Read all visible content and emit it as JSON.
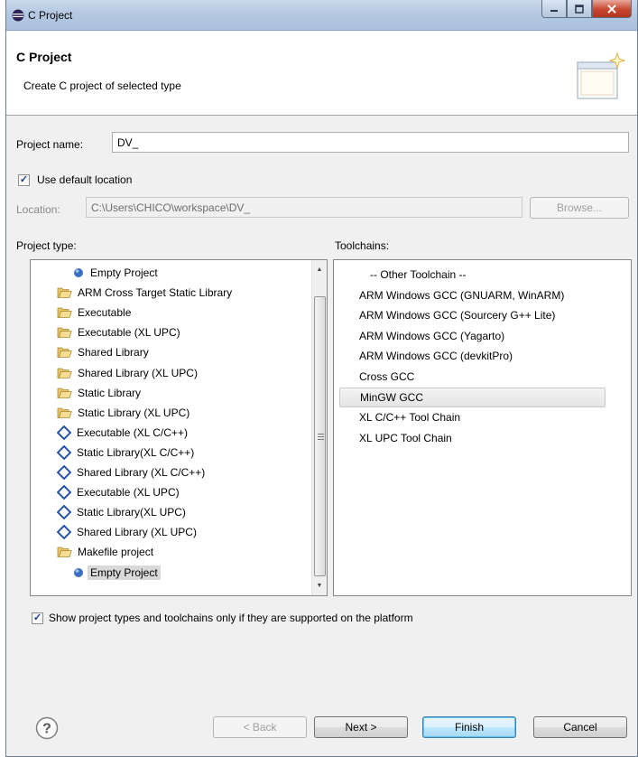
{
  "window": {
    "title": "C Project"
  },
  "banner": {
    "heading": "C Project",
    "description": "Create C project of selected type"
  },
  "project_name": {
    "label": "Project name:",
    "value": "DV_"
  },
  "default_location": {
    "label": "Use default location",
    "checked": true
  },
  "location": {
    "label": "Location:",
    "value": "C:\\Users\\CHICO\\workspace\\DV_",
    "browse_label": "Browse..."
  },
  "project_type": {
    "label": "Project type:",
    "items": [
      {
        "label": "Empty Project",
        "icon": "blue-dot-icon",
        "indent": 2
      },
      {
        "label": "ARM Cross Target Static Library",
        "icon": "folder-icon",
        "indent": 1
      },
      {
        "label": "Executable",
        "icon": "folder-icon",
        "indent": 1
      },
      {
        "label": "Executable (XL UPC)",
        "icon": "folder-icon",
        "indent": 1
      },
      {
        "label": "Shared Library",
        "icon": "folder-icon",
        "indent": 1
      },
      {
        "label": "Shared Library (XL UPC)",
        "icon": "folder-icon",
        "indent": 1
      },
      {
        "label": "Static Library",
        "icon": "folder-icon",
        "indent": 1
      },
      {
        "label": "Static Library (XL UPC)",
        "icon": "folder-icon",
        "indent": 1
      },
      {
        "label": "Executable (XL C/C++)",
        "icon": "diamond-icon",
        "indent": 1
      },
      {
        "label": "Static Library(XL C/C++)",
        "icon": "diamond-icon",
        "indent": 1
      },
      {
        "label": "Shared Library (XL C/C++)",
        "icon": "diamond-icon",
        "indent": 1
      },
      {
        "label": "Executable (XL UPC)",
        "icon": "diamond-icon",
        "indent": 1
      },
      {
        "label": "Static Library(XL UPC)",
        "icon": "diamond-icon",
        "indent": 1
      },
      {
        "label": "Shared Library (XL UPC)",
        "icon": "diamond-icon",
        "indent": 1
      },
      {
        "label": "Makefile project",
        "icon": "folder-icon",
        "indent": 1
      },
      {
        "label": "Empty Project",
        "icon": "blue-dot-icon",
        "indent": 2,
        "selected": true
      }
    ]
  },
  "toolchains": {
    "label": "Toolchains:",
    "items": [
      {
        "label": "-- Other Toolchain --"
      },
      {
        "label": "ARM Windows GCC (GNUARM, WinARM)"
      },
      {
        "label": "ARM Windows GCC (Sourcery G++ Lite)"
      },
      {
        "label": "ARM Windows GCC (Yagarto)"
      },
      {
        "label": "ARM Windows GCC (devkitPro)"
      },
      {
        "label": "Cross GCC"
      },
      {
        "label": "MinGW GCC",
        "selected": true
      },
      {
        "label": "XL C/C++ Tool Chain"
      },
      {
        "label": "XL UPC Tool Chain"
      }
    ]
  },
  "supported_filter": {
    "label": "Show project types and toolchains only if they are supported on the platform",
    "checked": true
  },
  "buttons": {
    "back": "< Back",
    "next": "Next >",
    "finish": "Finish",
    "cancel": "Cancel"
  },
  "colors": {
    "folder": "#e8c467",
    "diamond": "#2a55a8",
    "dot": "#3a6fc4"
  }
}
